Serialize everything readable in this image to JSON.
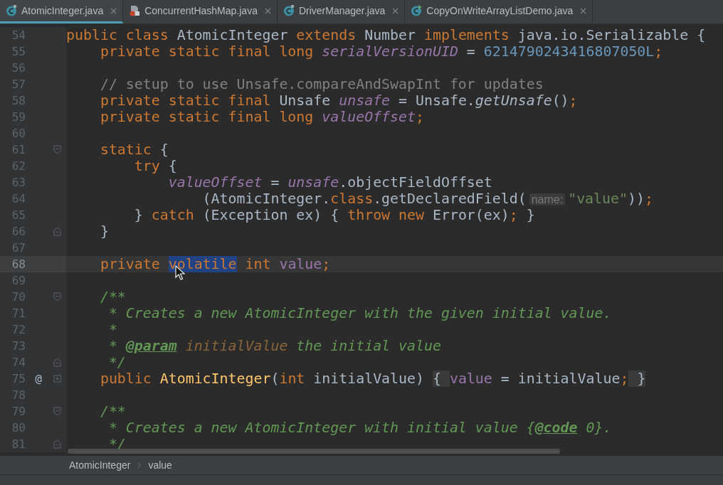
{
  "tabs": [
    {
      "label": "AtomicInteger.java",
      "kind": "class",
      "selected": true
    },
    {
      "label": "ConcurrentHashMap.java",
      "kind": "locked-file",
      "selected": false
    },
    {
      "label": "DriverManager.java",
      "kind": "class",
      "selected": false
    },
    {
      "label": "CopyOnWriteArrayListDemo.java",
      "kind": "runnable-class",
      "selected": false
    }
  ],
  "editor": {
    "lines": [
      {
        "number": "54",
        "kind": "plain",
        "current": false,
        "tokens": [
          {
            "kind": "kw",
            "t": "public class "
          },
          {
            "kind": "plain",
            "t": "AtomicInteger "
          },
          {
            "kind": "kw",
            "t": "extends "
          },
          {
            "kind": "plain",
            "t": "Number "
          },
          {
            "kind": "kw",
            "t": "implements "
          },
          {
            "kind": "plain",
            "t": "java.io.Serializable {"
          }
        ]
      },
      {
        "number": "55",
        "kind": "plain",
        "current": false,
        "tokens": [
          {
            "kind": "kw",
            "t": "    private static final long "
          },
          {
            "kind": "sfield",
            "t": "serialVersionUID"
          },
          {
            "kind": "plain",
            "t": " = "
          },
          {
            "kind": "num",
            "t": "6214790243416807050L"
          },
          {
            "kind": "kw",
            "t": ";"
          }
        ]
      },
      {
        "number": "56",
        "kind": "plain",
        "current": false
      },
      {
        "number": "57",
        "kind": "plain",
        "current": false,
        "tokens": [
          {
            "kind": "comment",
            "t": "    // setup to use Unsafe.compareAndSwapInt for updates"
          }
        ]
      },
      {
        "number": "58",
        "kind": "plain",
        "current": false,
        "tokens": [
          {
            "kind": "kw",
            "t": "    private static final "
          },
          {
            "kind": "plain",
            "t": "Unsafe "
          },
          {
            "kind": "sfield",
            "t": "unsafe"
          },
          {
            "kind": "plain",
            "t": " = Unsafe."
          },
          {
            "kind": "smethod",
            "t": "getUnsafe"
          },
          {
            "kind": "plain",
            "t": "()"
          },
          {
            "kind": "kw",
            "t": ";"
          }
        ]
      },
      {
        "number": "59",
        "kind": "plain",
        "current": false,
        "tokens": [
          {
            "kind": "kw",
            "t": "    private static final long "
          },
          {
            "kind": "sfield",
            "t": "valueOffset"
          },
          {
            "kind": "kw",
            "t": ";"
          }
        ]
      },
      {
        "number": "60",
        "kind": "plain",
        "current": false
      },
      {
        "number": "61",
        "kind": "fold-start",
        "current": false,
        "tokens": [
          {
            "kind": "kw",
            "t": "    static "
          },
          {
            "kind": "plain",
            "t": "{"
          }
        ]
      },
      {
        "number": "62",
        "kind": "plain",
        "current": false,
        "tokens": [
          {
            "kind": "kw",
            "t": "        try "
          },
          {
            "kind": "plain",
            "t": "{"
          }
        ]
      },
      {
        "number": "63",
        "kind": "plain",
        "current": false,
        "tokens": [
          {
            "kind": "sfield",
            "t": "            valueOffset"
          },
          {
            "kind": "plain",
            "t": " = "
          },
          {
            "kind": "sfield",
            "t": "unsafe"
          },
          {
            "kind": "plain",
            "t": ".objectFieldOffset"
          }
        ]
      },
      {
        "number": "64",
        "kind": "plain",
        "current": false,
        "tokens": [
          {
            "kind": "plain",
            "t": "                (AtomicInteger."
          },
          {
            "kind": "kw",
            "t": "class"
          },
          {
            "kind": "plain",
            "t": ".getDeclaredField("
          },
          {
            "kind": "hint",
            "t": "name:"
          },
          {
            "kind": "str",
            "t": "\"value\""
          },
          {
            "kind": "plain",
            "t": "))"
          },
          {
            "kind": "kw",
            "t": ";"
          }
        ]
      },
      {
        "number": "65",
        "kind": "plain",
        "current": false,
        "tokens": [
          {
            "kind": "plain",
            "t": "        } "
          },
          {
            "kind": "kw",
            "t": "catch "
          },
          {
            "kind": "plain",
            "t": "(Exception ex) { "
          },
          {
            "kind": "kw",
            "t": "throw new "
          },
          {
            "kind": "plain",
            "t": "Error(ex)"
          },
          {
            "kind": "kw",
            "t": "; "
          },
          {
            "kind": "plain",
            "t": "}"
          }
        ]
      },
      {
        "number": "66",
        "kind": "fold-end",
        "current": false,
        "tokens": [
          {
            "kind": "plain",
            "t": "    }"
          }
        ]
      },
      {
        "number": "67",
        "kind": "plain",
        "current": false
      },
      {
        "number": "68",
        "kind": "plain",
        "current": true,
        "tokens": [
          {
            "kind": "kw",
            "t": "    private "
          },
          {
            "kind": "sel",
            "t": "volatile"
          },
          {
            "kind": "kw",
            "t": " int "
          },
          {
            "kind": "field",
            "t": "value"
          },
          {
            "kind": "kw",
            "t": ";"
          }
        ]
      },
      {
        "number": "69",
        "kind": "plain",
        "current": false
      },
      {
        "number": "70",
        "kind": "fold-start",
        "current": false,
        "tokens": [
          {
            "kind": "doc",
            "t": "    /**"
          }
        ]
      },
      {
        "number": "71",
        "kind": "plain",
        "current": false,
        "tokens": [
          {
            "kind": "doc",
            "t": "     * Creates a new AtomicInteger with the given initial value."
          }
        ]
      },
      {
        "number": "72",
        "kind": "plain",
        "current": false,
        "tokens": [
          {
            "kind": "doc",
            "t": "     *"
          }
        ]
      },
      {
        "number": "73",
        "kind": "plain",
        "current": false,
        "tokens": [
          {
            "kind": "doc",
            "t": "     * "
          },
          {
            "kind": "doctag",
            "t": "@param"
          },
          {
            "kind": "docparam",
            "t": " initialValue"
          },
          {
            "kind": "doc",
            "t": " the initial value"
          }
        ]
      },
      {
        "number": "74",
        "kind": "fold-end",
        "current": false,
        "tokens": [
          {
            "kind": "doc",
            "t": "     */"
          }
        ]
      },
      {
        "number": "75",
        "kind": "fold-collapsed",
        "current": false,
        "marker": "@",
        "tokens": [
          {
            "kind": "kw",
            "t": "    public "
          },
          {
            "kind": "fn",
            "t": "AtomicInteger"
          },
          {
            "kind": "plain",
            "t": "("
          },
          {
            "kind": "kw",
            "t": "int "
          },
          {
            "kind": "plain",
            "t": "initialValue) "
          },
          {
            "kind": "folded",
            "t": "{ "
          },
          {
            "kind": "field",
            "t": "value"
          },
          {
            "kind": "plain",
            "t": " = initialValue"
          },
          {
            "kind": "kw",
            "t": ";"
          },
          {
            "kind": "folded",
            "t": " }"
          }
        ]
      },
      {
        "number": "78",
        "kind": "plain",
        "current": false
      },
      {
        "number": "79",
        "kind": "fold-start",
        "current": false,
        "tokens": [
          {
            "kind": "doc",
            "t": "    /**"
          }
        ]
      },
      {
        "number": "80",
        "kind": "plain",
        "current": false,
        "tokens": [
          {
            "kind": "doc",
            "t": "     * Creates a new AtomicInteger with initial value {"
          },
          {
            "kind": "doctag",
            "t": "@code"
          },
          {
            "kind": "doc",
            "t": " 0}."
          }
        ]
      },
      {
        "number": "81",
        "kind": "fold-end",
        "current": false,
        "tokens": [
          {
            "kind": "doc",
            "t": "     */"
          }
        ]
      }
    ]
  },
  "breadcrumbs": [
    "AtomicInteger",
    "value"
  ]
}
